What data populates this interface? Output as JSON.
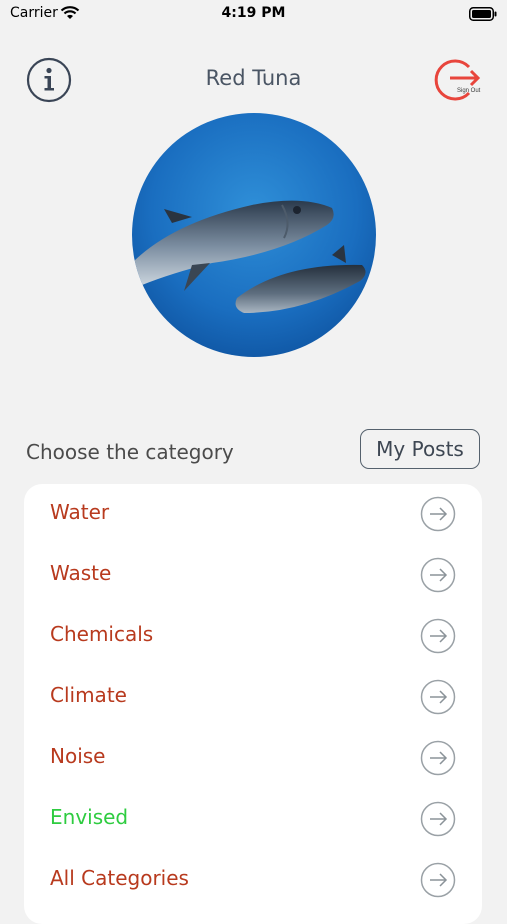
{
  "status_bar": {
    "carrier": "Carrier",
    "time": "4:19 PM"
  },
  "header": {
    "title": "Red Tuna",
    "info_icon": "info-circle-icon",
    "signout_icon": "sign-out-icon",
    "signout_label": "Sign Out"
  },
  "avatar": {
    "description": "tuna-photo"
  },
  "categories_section": {
    "label": "Choose the category",
    "my_posts_label": "My Posts"
  },
  "colors": {
    "category_text": "#b83a1e",
    "envised_text": "#2ecc40",
    "signout_red": "#e8453c",
    "title_text": "#4a5564"
  },
  "categories": [
    {
      "label": "Water"
    },
    {
      "label": "Waste"
    },
    {
      "label": "Chemicals"
    },
    {
      "label": "Climate"
    },
    {
      "label": "Noise"
    },
    {
      "label": "Envised"
    },
    {
      "label": "All Categories"
    }
  ]
}
